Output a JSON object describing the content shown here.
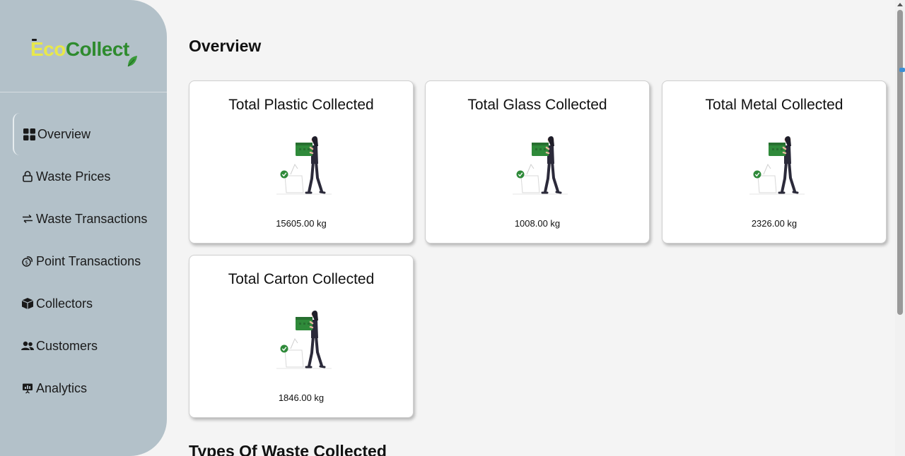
{
  "app": {
    "logo_eco": "Eco",
    "logo_collect": "Collect"
  },
  "sidebar": {
    "items": [
      {
        "label": "Overview",
        "icon": "grid-icon",
        "active": true
      },
      {
        "label": "Waste Prices",
        "icon": "lock-icon",
        "active": false
      },
      {
        "label": "Waste Transactions",
        "icon": "swap-arrows-icon",
        "active": false
      },
      {
        "label": "Point Transactions",
        "icon": "coins-icon",
        "active": false
      },
      {
        "label": "Collectors",
        "icon": "box-icon",
        "active": false
      },
      {
        "label": "Customers",
        "icon": "people-icon",
        "active": false
      },
      {
        "label": "Analytics",
        "icon": "presentation-chart-icon",
        "active": false
      }
    ]
  },
  "main": {
    "title": "Overview",
    "cards": [
      {
        "title": "Total Plastic Collected",
        "value": "15605.00 kg"
      },
      {
        "title": "Total Glass Collected",
        "value": "1008.00 kg"
      },
      {
        "title": "Total Metal Collected",
        "value": "2326.00 kg"
      },
      {
        "title": "Total Carton Collected",
        "value": "1846.00 kg"
      }
    ],
    "section_title": "Types Of Waste Collected"
  },
  "colors": {
    "sidebar_bg": "#b3c1c9",
    "page_bg": "#f4f4f4",
    "logo_eco": "#e8e84a",
    "logo_collect": "#2e8b2e",
    "illustration_green": "#2f8a3a"
  }
}
